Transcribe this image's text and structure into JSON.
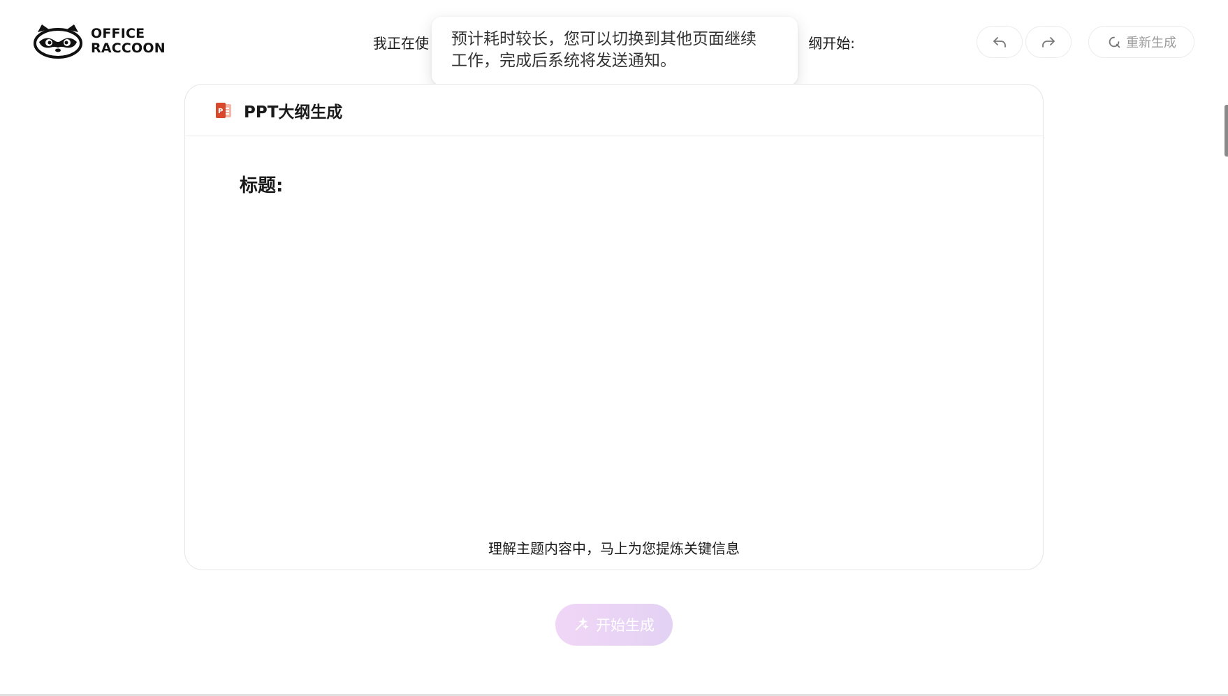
{
  "logo": {
    "line1": "OFFICE",
    "line2": "RACCOON"
  },
  "prompt": {
    "left_text": "我正在使",
    "right_text": "纲开始:"
  },
  "toast": {
    "line1": "预计耗时较长，您可以切换到其他页面继续",
    "line2": "工作，完成后系统将发送通知。"
  },
  "toolbar": {
    "undo_icon": "undo-icon",
    "redo_icon": "redo-icon",
    "regenerate_label": "重新生成"
  },
  "card": {
    "title": "PPT大纲生成",
    "heading": "标题:",
    "status": "理解主题内容中，马上为您提炼关键信息"
  },
  "start_button": {
    "label": "开始生成"
  },
  "colors": {
    "accent_gradient_start": "#f1d6f6",
    "accent_gradient_end": "#e3d2f4",
    "ppt_red": "#d9482b"
  }
}
